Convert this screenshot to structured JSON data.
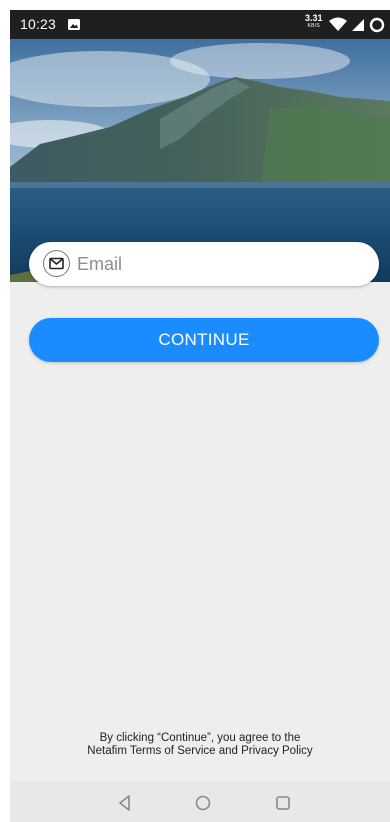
{
  "status_bar": {
    "time": "10:23",
    "net_speed_value": "3.31",
    "net_speed_unit": "KB/S",
    "icons": [
      "image-icon",
      "wifi-icon",
      "signal-icon",
      "battery-icon"
    ]
  },
  "login": {
    "email_placeholder": "Email",
    "email_value": "",
    "email_icon": "mail-icon",
    "continue_label": "CONTINUE"
  },
  "footer": {
    "terms_line1": "By clicking “Continue”, you agree to the",
    "terms_line2": "Netafim Terms of Service and Privacy Policy"
  },
  "nav_bar": {
    "icons": [
      "back-icon",
      "home-icon",
      "recents-icon"
    ]
  },
  "colors": {
    "accent": "#1a8cff",
    "background": "#eeeeee",
    "status_bar": "#1f1f1f"
  }
}
